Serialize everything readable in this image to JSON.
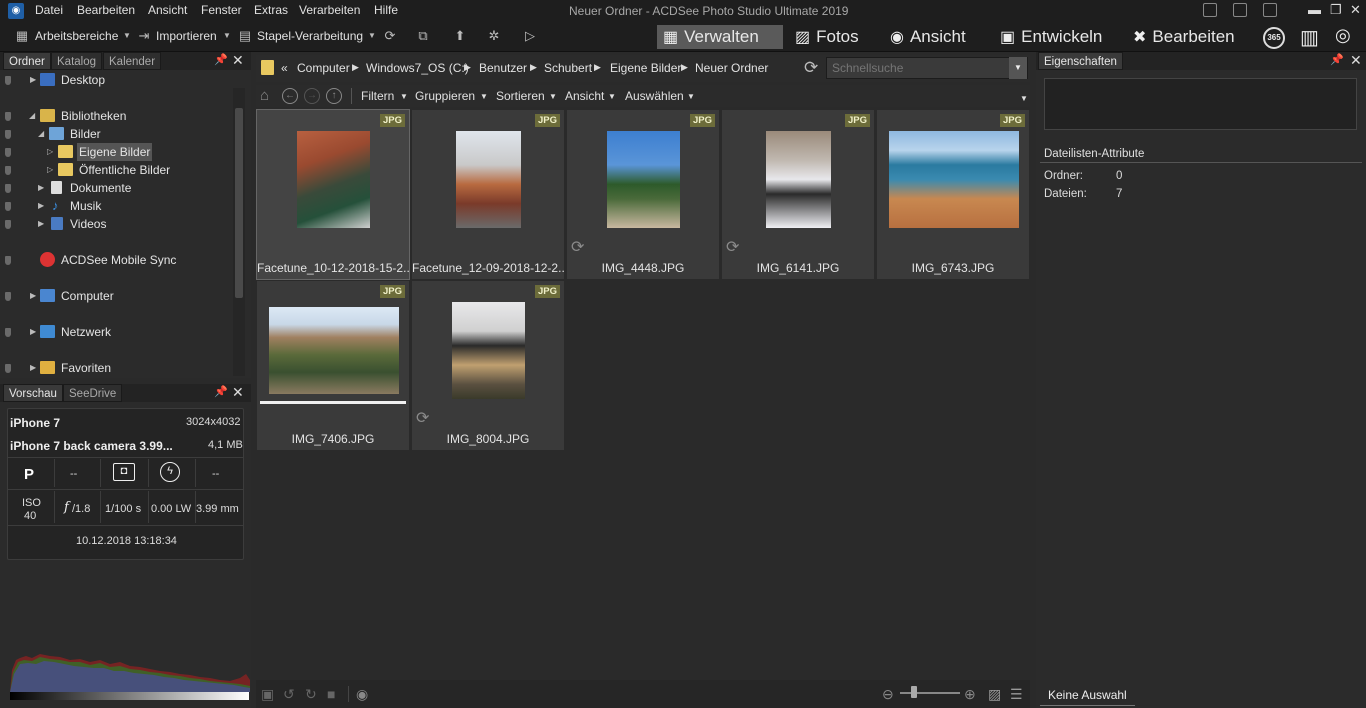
{
  "menubar": {
    "items": [
      "Datei",
      "Bearbeiten",
      "Ansicht",
      "Fenster",
      "Extras",
      "Verarbeiten",
      "Hilfe"
    ],
    "window_title": "Neuer Ordner - ACDSee Photo Studio Ultimate 2019"
  },
  "toolbar": {
    "workspaces": "Arbeitsbereiche",
    "import": "Importieren",
    "batch": "Stapel-Verarbeitung",
    "modes": [
      "Verwalten",
      "Fotos",
      "Ansicht",
      "Entwickeln",
      "Bearbeiten"
    ],
    "badge_365": "365"
  },
  "folder_panel": {
    "tabs": [
      "Ordner",
      "Katalog",
      "Kalender"
    ],
    "tree": [
      {
        "label": "Desktop"
      },
      {
        "label": "Bibliotheken"
      },
      {
        "label": "Bilder"
      },
      {
        "label": "Eigene Bilder"
      },
      {
        "label": "Öffentliche Bilder"
      },
      {
        "label": "Dokumente"
      },
      {
        "label": "Musik"
      },
      {
        "label": "Videos"
      },
      {
        "label": "ACDSee Mobile Sync"
      },
      {
        "label": "Computer"
      },
      {
        "label": "Netzwerk"
      },
      {
        "label": "Favoriten"
      }
    ]
  },
  "preview_panel": {
    "tabs": [
      "Vorschau",
      "SeeDrive"
    ],
    "camera": "iPhone 7",
    "resolution": "3024x4032",
    "lens": "iPhone 7 back camera 3.99...",
    "filesize": "4,1 MB",
    "mode": "P",
    "dash1": "--",
    "dash2": "--",
    "iso_label": "ISO",
    "iso_value": "40",
    "aperture_f": "f",
    "aperture": "/1.8",
    "shutter": "1/100 s",
    "exposure": "0.00 LW",
    "focal": "3.99 mm",
    "datetime": "10.12.2018 13:18:34"
  },
  "pathbar": {
    "back": "«",
    "crumbs": [
      "Computer",
      "Windows7_OS (C:)",
      "Benutzer",
      "Schubert",
      "Eigene Bilder",
      "Neuer Ordner"
    ],
    "search_placeholder": "Schnellsuche"
  },
  "filterbar": {
    "items": [
      "Filtern",
      "Gruppieren",
      "Sortieren",
      "Ansicht",
      "Auswählen"
    ]
  },
  "files": [
    {
      "name": "Facetune_10-12-2018-15-2...",
      "type": "JPG"
    },
    {
      "name": "Facetune_12-09-2018-12-2...",
      "type": "JPG"
    },
    {
      "name": "IMG_4448.JPG",
      "type": "JPG"
    },
    {
      "name": "IMG_6141.JPG",
      "type": "JPG"
    },
    {
      "name": "IMG_6743.JPG",
      "type": "JPG"
    },
    {
      "name": "IMG_7406.JPG",
      "type": "JPG"
    },
    {
      "name": "IMG_8004.JPG",
      "type": "JPG"
    }
  ],
  "properties": {
    "title": "Eigenschaften",
    "section": "Dateilisten-Attribute",
    "folders_label": "Ordner:",
    "folders_value": "0",
    "files_label": "Dateien:",
    "files_value": "7",
    "bottom_tab": "Keine Auswahl"
  },
  "colors": {
    "accent_mode": "#5a5a5a",
    "jpg_badge": "#6c6c3a"
  }
}
